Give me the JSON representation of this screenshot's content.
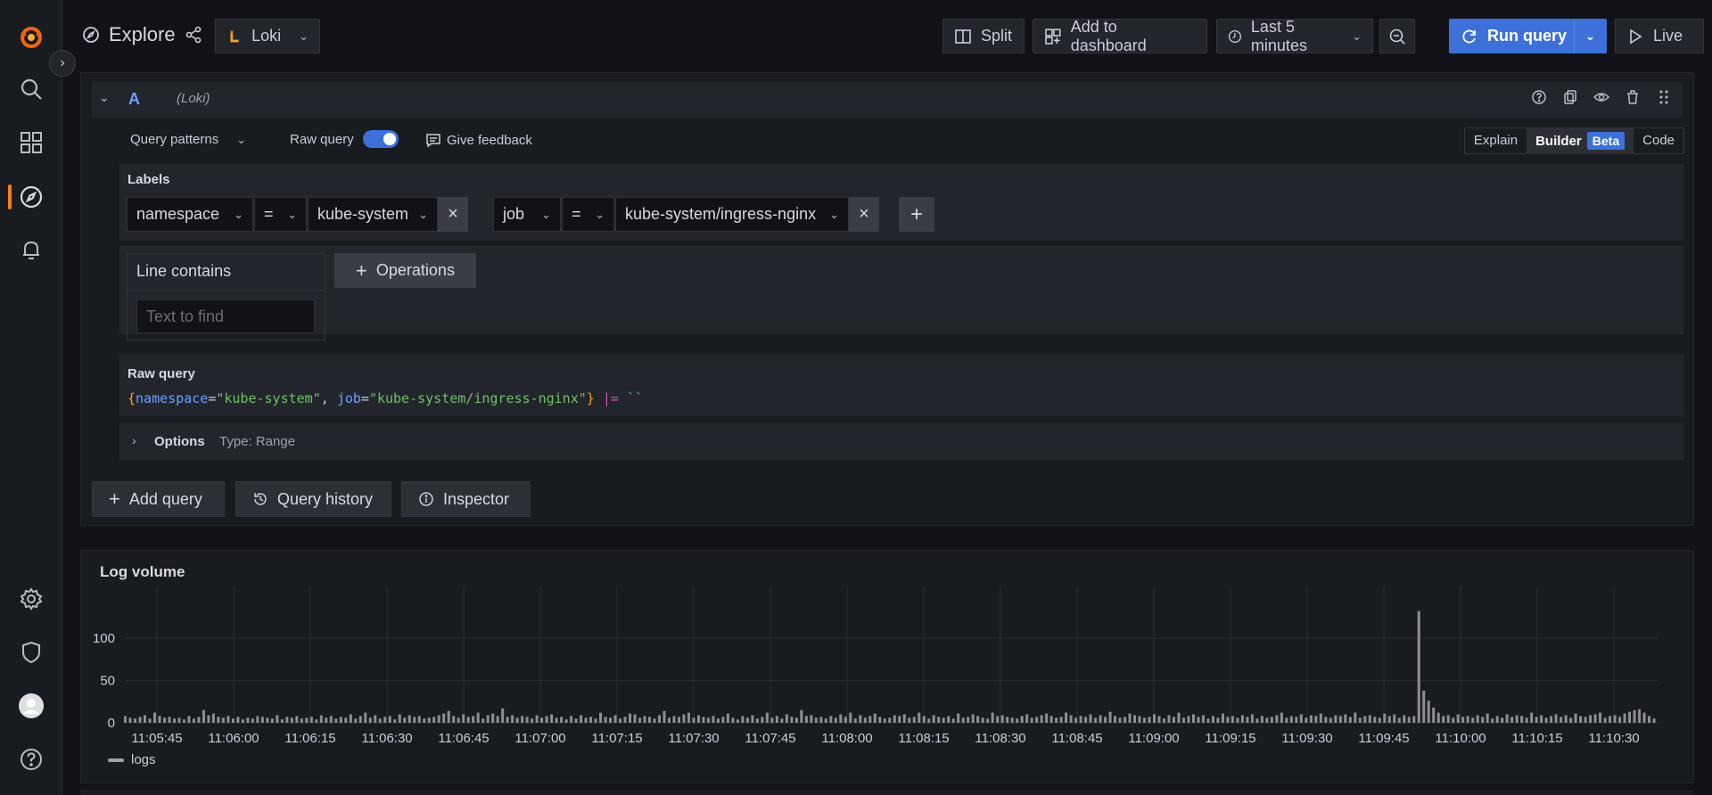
{
  "header": {
    "title": "Explore",
    "datasource": "Loki",
    "split_label": "Split",
    "add_to_dashboard_label": "Add to dashboard",
    "time_range_label": "Last 5 minutes",
    "run_query_label": "Run query",
    "live_label": "Live"
  },
  "query_row": {
    "ref_id": "A",
    "datasource_tag": "(Loki)",
    "query_patterns_label": "Query patterns",
    "raw_query_toggle_label": "Raw query",
    "raw_query_enabled": true,
    "give_feedback_label": "Give feedback",
    "modes": {
      "explain": "Explain",
      "builder": "Builder",
      "beta": "Beta",
      "code": "Code"
    },
    "labels_title": "Labels",
    "filters": [
      {
        "label": "namespace",
        "op": "=",
        "value": "kube-system"
      },
      {
        "label": "job",
        "op": "=",
        "value": "kube-system/ingress-nginx"
      }
    ],
    "line_contains_title": "Line contains",
    "text_to_find_placeholder": "Text to find",
    "operations_label": "Operations",
    "raw_query_title": "Raw query",
    "raw_query": {
      "open_brace": "{",
      "key1": "namespace",
      "eq1": "=",
      "val1": "\"kube-system\"",
      "sep": ", ",
      "key2": "job",
      "eq2": "=",
      "val2": "\"kube-system/ingress-nginx\"",
      "close_brace": "}",
      "pipe": "|=",
      "arg": "``"
    },
    "options_label": "Options",
    "options_type": "Type: Range"
  },
  "actions": {
    "add_query": "Add query",
    "query_history": "Query history",
    "inspector": "Inspector"
  },
  "log_volume": {
    "title": "Log volume",
    "legend": "logs",
    "y_ticks": [
      "100",
      "50",
      "0"
    ],
    "x_ticks": [
      "11:05:45",
      "11:06:00",
      "11:06:15",
      "11:06:30",
      "11:06:45",
      "11:07:00",
      "11:07:15",
      "11:07:30",
      "11:07:45",
      "11:08:00",
      "11:08:15",
      "11:08:30",
      "11:08:45",
      "11:09:00",
      "11:09:15",
      "11:09:30",
      "11:09:45",
      "11:10:00",
      "11:10:15",
      "11:10:30"
    ]
  },
  "chart_data": {
    "type": "bar",
    "title": "Log volume",
    "series": [
      {
        "name": "logs",
        "values": [
          8,
          6,
          5,
          7,
          9,
          5,
          12,
          8,
          6,
          7,
          5,
          6,
          4,
          8,
          5,
          7,
          15,
          9,
          11,
          7,
          6,
          8,
          5,
          7,
          4,
          6,
          5,
          8,
          7,
          6,
          5,
          9,
          4,
          7,
          6,
          8,
          5,
          6,
          7,
          4,
          9,
          6,
          8,
          5,
          7,
          6,
          10,
          5,
          8,
          12,
          6,
          9,
          5,
          7,
          8,
          4,
          10,
          6,
          9,
          7,
          8,
          5,
          6,
          7,
          9,
          11,
          14,
          8,
          6,
          10,
          7,
          8,
          12,
          5,
          9,
          11,
          8,
          17,
          7,
          9,
          6,
          8,
          7,
          5,
          9,
          6,
          8,
          10,
          6,
          7,
          4,
          8,
          5,
          9,
          6,
          7,
          5,
          12,
          7,
          6,
          9,
          5,
          7,
          11,
          10,
          6,
          8,
          7,
          5,
          9,
          14,
          6,
          8,
          7,
          10,
          12,
          6,
          9,
          7,
          6,
          8,
          5,
          7,
          11,
          6,
          4,
          8,
          6,
          9,
          5,
          7,
          12,
          6,
          8,
          5,
          10,
          7,
          6,
          15,
          8,
          9,
          6,
          7,
          5,
          8,
          6,
          10,
          7,
          12,
          5,
          9,
          6,
          8,
          11,
          7,
          5,
          6,
          9,
          8,
          10,
          6,
          7,
          12,
          8,
          5,
          9,
          7,
          6,
          8,
          5,
          11,
          6,
          7,
          10,
          8,
          6,
          5,
          12,
          8,
          9,
          7,
          6,
          5,
          8,
          10,
          6,
          7,
          9,
          11,
          8,
          6,
          7,
          12,
          9,
          6,
          8,
          7,
          10,
          6,
          9,
          7,
          13,
          8,
          6,
          7,
          11,
          9,
          8,
          6,
          7,
          10,
          8,
          5,
          9,
          7,
          12,
          6,
          8,
          10,
          7,
          9,
          5,
          8,
          6,
          11,
          7,
          8,
          6,
          9,
          7,
          10,
          5,
          8,
          6,
          7,
          9,
          12,
          6,
          8,
          7,
          10,
          6,
          9,
          8,
          11,
          7,
          6,
          9,
          8,
          10,
          7,
          12,
          6,
          8,
          9,
          7,
          6,
          11,
          8,
          10,
          6,
          9,
          7,
          8,
          132,
          38,
          26,
          18,
          12,
          8,
          9,
          6,
          10,
          7,
          8,
          6,
          9,
          7,
          11,
          5,
          8,
          6,
          10,
          7,
          9,
          8,
          6,
          12,
          7,
          9,
          6,
          8,
          10,
          7,
          9,
          6,
          11,
          8,
          7,
          9,
          10,
          12,
          6,
          8,
          9,
          7,
          11,
          13,
          15,
          16,
          12,
          8,
          5
        ]
      }
    ],
    "ylim": [
      0,
      140
    ],
    "y_ticks": [
      0,
      50,
      100
    ],
    "x_range": [
      "11:05:42",
      "11:10:42"
    ],
    "grid": true,
    "legend": "bottom-left"
  }
}
